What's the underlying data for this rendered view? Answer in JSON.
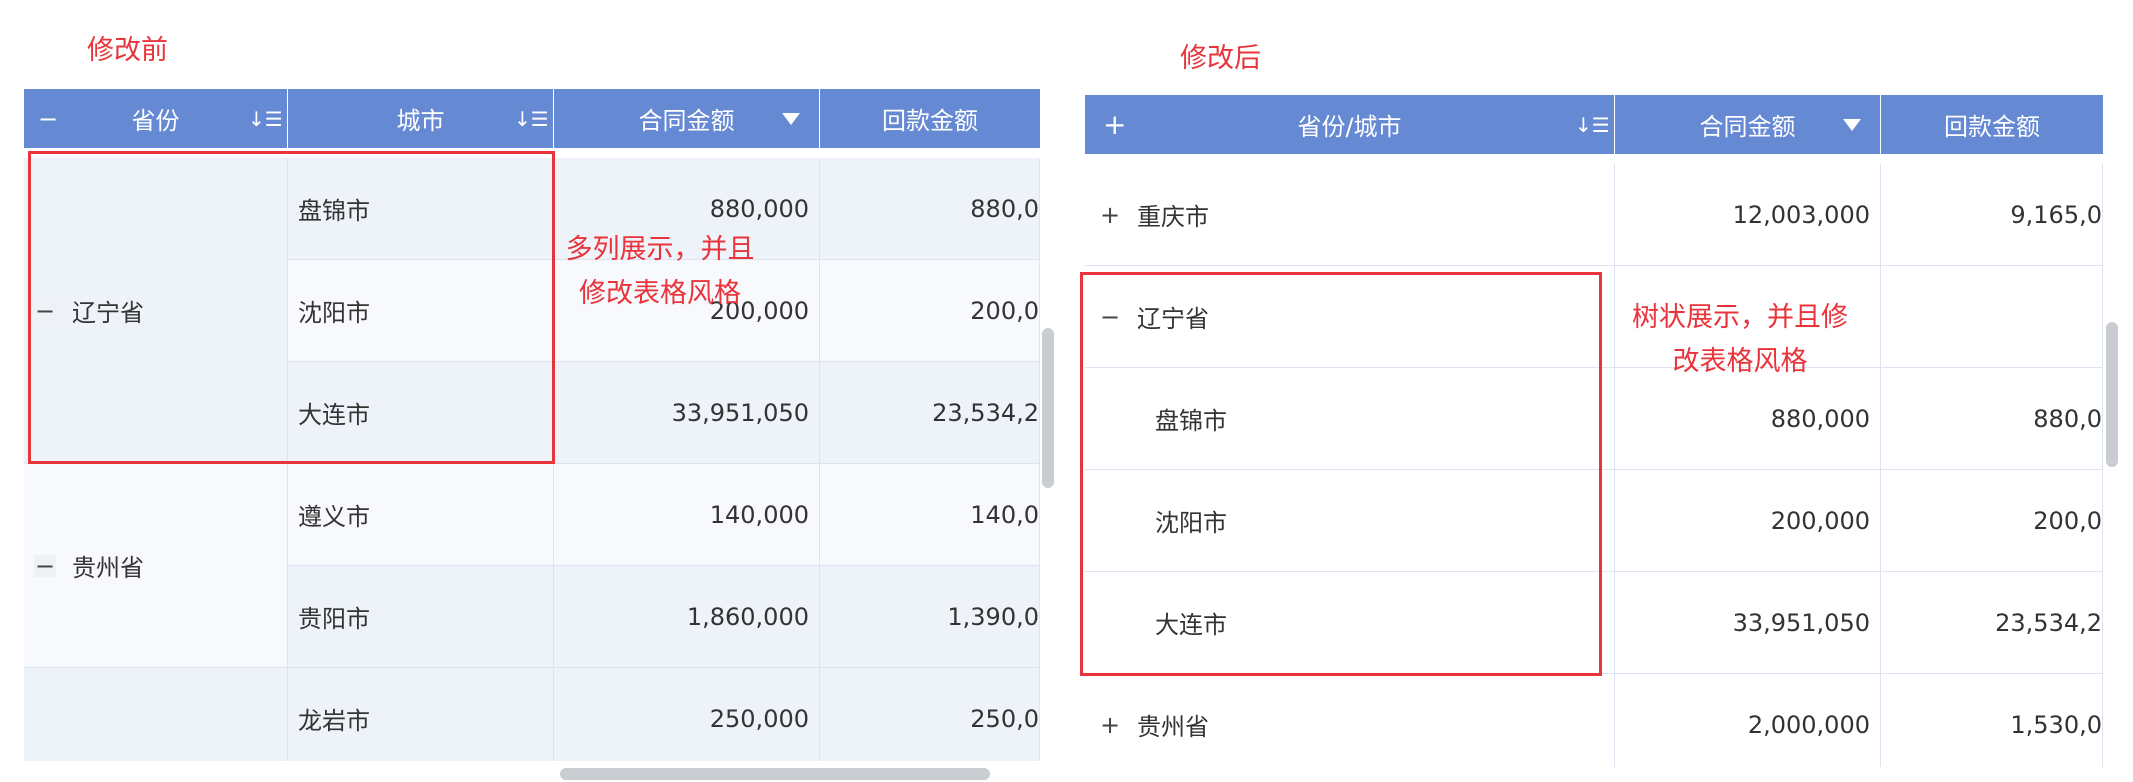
{
  "left": {
    "caption": "修改前",
    "header": {
      "toggle": "−",
      "province": "省份",
      "city": "城市",
      "contract": "合同金额",
      "payment": "回款金额",
      "sort_icon": "↓☰"
    },
    "annotation": [
      "多列展示，并且",
      "修改表格风格"
    ],
    "groups": [
      {
        "toggle": "−",
        "province": "辽宁省",
        "rows": [
          {
            "city": "盘锦市",
            "contract": "880,000",
            "payment": "880,0"
          },
          {
            "city": "沈阳市",
            "contract": "200,000",
            "payment": "200,0"
          },
          {
            "city": "大连市",
            "contract": "33,951,050",
            "payment": "23,534,2"
          }
        ]
      },
      {
        "toggle": "−",
        "province": "贵州省",
        "rows": [
          {
            "city": "遵义市",
            "contract": "140,000",
            "payment": "140,0"
          },
          {
            "city": "贵阳市",
            "contract": "1,860,000",
            "payment": "1,390,0"
          }
        ]
      },
      {
        "toggle": "",
        "province": "",
        "rows": [
          {
            "city": "龙岩市",
            "contract": "250,000",
            "payment": "250,0"
          }
        ]
      }
    ]
  },
  "right": {
    "caption": "修改后",
    "header": {
      "toggle": "+",
      "name": "省份/城市",
      "contract": "合同金额",
      "payment": "回款金额",
      "sort_icon": "↓☰"
    },
    "annotation": [
      "树状展示，并且修",
      "改表格风格"
    ],
    "rows": [
      {
        "toggle": "+",
        "name": "重庆市",
        "contract": "12,003,000",
        "payment": "9,165,0"
      },
      {
        "toggle": "−",
        "name": "辽宁省",
        "contract": "",
        "payment": ""
      },
      {
        "toggle": "",
        "name": "盘锦市",
        "contract": "880,000",
        "payment": "880,0"
      },
      {
        "toggle": "",
        "name": "沈阳市",
        "contract": "200,000",
        "payment": "200,0"
      },
      {
        "toggle": "",
        "name": "大连市",
        "contract": "33,951,050",
        "payment": "23,534,2"
      },
      {
        "toggle": "+",
        "name": "贵州省",
        "contract": "2,000,000",
        "payment": "1,530,0"
      }
    ]
  },
  "colors": {
    "header": "#6689d4",
    "annotation": "#e8343a",
    "row_alt": "#eef2f9"
  }
}
